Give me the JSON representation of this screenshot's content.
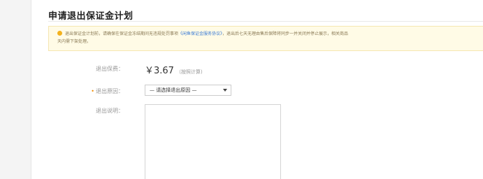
{
  "page": {
    "title": "申请退出保证金计划"
  },
  "notice": {
    "icon": "warning-icon",
    "line1_text": "退出保证金计划前，请确保在保证金冻结期间无违规处罚事项",
    "line1_link": "《闲鱼保证金服务协议》",
    "line1_rest": "，退出后七天无理由售后保障将同步一并关闭并停止展示，相关商品",
    "line2_text": "天内需下架处理。"
  },
  "form": {
    "amount_label": "退出保费：",
    "amount_value": "￥3.67",
    "amount_note": "（按照计算)",
    "reason_label": "退出原因：",
    "reason_select_value": "— 请选择退出原因 —",
    "explain_label": "退出说明："
  }
}
